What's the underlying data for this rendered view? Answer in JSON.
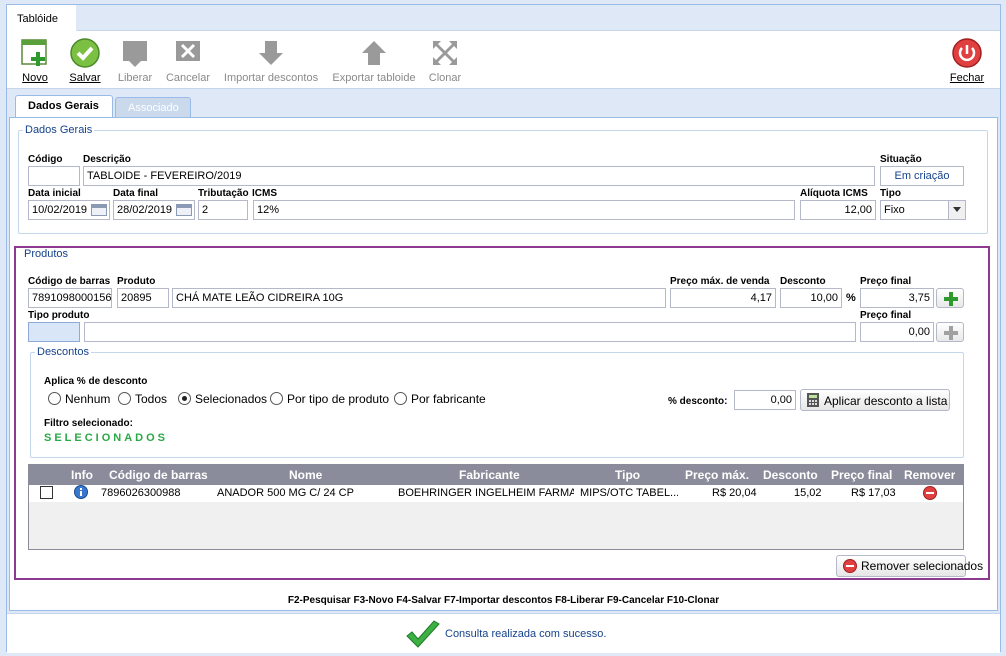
{
  "window": {
    "title": "Tablóide"
  },
  "toolbar": {
    "novo": "Novo",
    "salvar": "Salvar",
    "liberar": "Liberar",
    "cancelar": "Cancelar",
    "importar": "Importar descontos",
    "exportar": "Exportar tabloide",
    "clonar": "Clonar",
    "fechar": "Fechar"
  },
  "tabs": [
    {
      "label": "Dados Gerais",
      "active": true
    },
    {
      "label": "Associado",
      "active": false
    }
  ],
  "dados_gerais": {
    "legend": "Dados Gerais",
    "codigo_label": "Código",
    "codigo_value": "",
    "descricao_label": "Descrição",
    "descricao_value": "TABLOIDE - FEVEREIRO/2019",
    "situacao_label": "Situação",
    "situacao_value": "Em criação",
    "data_inicial_label": "Data inicial",
    "data_inicial_value": "10/02/2019",
    "data_final_label": "Data final",
    "data_final_value": "28/02/2019",
    "tributacao_label": "Tributação",
    "tributacao_value": "2",
    "icms_label": "ICMS",
    "icms_value": "12%",
    "aliquota_label": "Alíquota ICMS",
    "aliquota_value": "12,00",
    "tipo_label": "Tipo",
    "tipo_value": "Fixo"
  },
  "produtos": {
    "legend": "Produtos",
    "codigo_barras_label": "Código de barras",
    "codigo_barras_value": "7891098000156",
    "produto_label": "Produto",
    "produto_codigo": "20895",
    "produto_nome": "CHÁ MATE LEÃO CIDREIRA 10G",
    "preco_max_label": "Preço máx. de venda",
    "preco_max_value": "4,17",
    "desconto_label": "Desconto",
    "desconto_value": "10,00",
    "percent_symbol": "%",
    "preco_final_label": "Preço final",
    "preco_final_value": "3,75",
    "tipo_produto_label": "Tipo produto",
    "tipo_produto_codigo": "",
    "tipo_produto_nome": "",
    "preco_final2_label": "Preço final",
    "preco_final2_value": "0,00"
  },
  "descontos": {
    "legend": "Descontos",
    "aplica_label": "Aplica % de desconto",
    "options": [
      "Nenhum",
      "Todos",
      "Selecionados",
      "Por tipo de produto",
      "Por fabricante"
    ],
    "selected": "Selecionados",
    "percent_label": "% desconto:",
    "percent_value": "0,00",
    "apply_button": "Aplicar desconto a lista",
    "filtro_label": "Filtro selecionado:",
    "filtro_value": "SELECIONADOS"
  },
  "grid": {
    "columns": [
      "Info",
      "Código de barras",
      "Nome",
      "Fabricante",
      "Tipo",
      "Preço máx.",
      "Desconto",
      "Preço final",
      "Remover"
    ],
    "rows": [
      {
        "codigo": "7896026300988",
        "nome": "ANADOR 500 MG C/ 24 CP",
        "fabricante": "BOEHRINGER INGELHEIM FARMA...",
        "tipo": "MIPS/OTC TABEL...",
        "preco_max": "R$ 20,04",
        "desconto": "15,02",
        "preco_final": "R$ 17,03"
      }
    ]
  },
  "remover_selecionados": "Remover selecionados",
  "shortcuts": "F2-Pesquisar F3-Novo F4-Salvar F7-Importar descontos F8-Liberar F9-Cancelar F10-Clonar",
  "status_message": "Consulta realizada com sucesso.",
  "colors": {
    "accent": "#15428b",
    "highlight_border": "#8b3a8f",
    "success": "#2aa845"
  }
}
